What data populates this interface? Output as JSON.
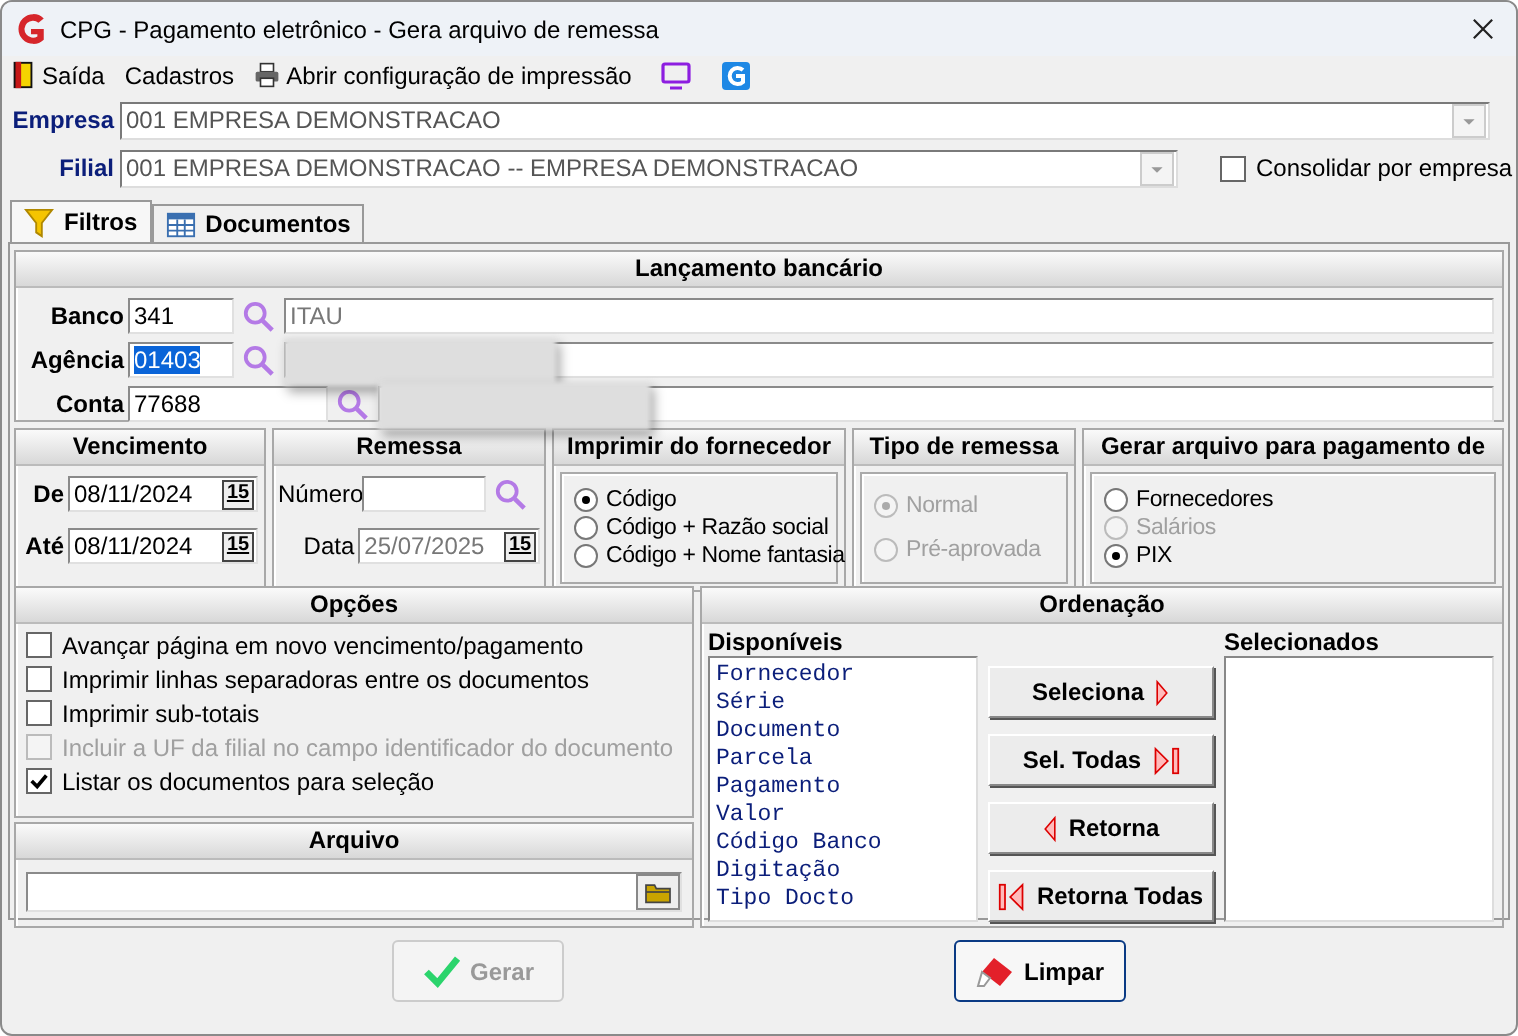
{
  "window": {
    "title": "CPG -  Pagamento eletrônico - Gera arquivo de remessa"
  },
  "menu": [
    {
      "label": "Saída"
    },
    {
      "label": "Cadastros"
    },
    {
      "label": "Abrir configuração de impressão"
    }
  ],
  "empresa": {
    "label": "Empresa",
    "value": "001 EMPRESA DEMONSTRACAO"
  },
  "filial": {
    "label": "Filial",
    "value": "001 EMPRESA DEMONSTRACAO -- EMPRESA DEMONSTRACAO"
  },
  "consolidar": {
    "label": "Consolidar por empresa",
    "checked": false
  },
  "tabs": [
    {
      "label": "Filtros",
      "selected": true
    },
    {
      "label": "Documentos",
      "selected": false
    }
  ],
  "lancamento": {
    "title": "Lançamento bancário",
    "fields": [
      {
        "label": "Banco",
        "value": "341",
        "name": "ITAU",
        "selected": false,
        "redacted": false
      },
      {
        "label": "Agência",
        "value": "01403",
        "selected": true,
        "redacted": true
      },
      {
        "label": "Conta",
        "value": "77688",
        "selected": false,
        "redacted": true
      }
    ]
  },
  "vencimento": {
    "title": "Vencimento",
    "fields": [
      {
        "label": "De",
        "value": "08/11/2024",
        "button": "15"
      },
      {
        "label": "Até",
        "value": "08/11/2024",
        "button": "15"
      }
    ]
  },
  "remessa": {
    "title": "Remessa",
    "numero": {
      "label": "Número"
    },
    "data": {
      "label": "Data",
      "value": "25/07/2025",
      "button": "15",
      "disabled": true
    }
  },
  "imprimir": {
    "title": "Imprimir do fornecedor",
    "options": [
      {
        "label": "Código",
        "selected": true,
        "disabled": false
      },
      {
        "label": "Código + Razão social",
        "selected": false,
        "disabled": false
      },
      {
        "label": "Código + Nome fantasia",
        "selected": false,
        "disabled": false
      }
    ]
  },
  "tipo_remessa": {
    "title": "Tipo de remessa",
    "options": [
      {
        "label": "Normal",
        "selected": true,
        "disabled": true
      },
      {
        "label": "Pré-aprovada",
        "selected": false,
        "disabled": true
      }
    ]
  },
  "gerar_para": {
    "title": "Gerar arquivo para pagamento de",
    "options": [
      {
        "label": "Fornecedores",
        "selected": false,
        "disabled": false
      },
      {
        "label": "Salários",
        "selected": false,
        "disabled": true
      },
      {
        "label": "PIX",
        "selected": true,
        "disabled": false
      }
    ]
  },
  "opcoes": {
    "title": "Opções",
    "items": [
      {
        "label": "Avançar página em novo vencimento/pagamento",
        "checked": false,
        "disabled": false
      },
      {
        "label": "Imprimir linhas separadoras entre os documentos",
        "checked": false,
        "disabled": false
      },
      {
        "label": "Imprimir sub-totais",
        "checked": false,
        "disabled": false
      },
      {
        "label": "Incluir a UF da filial no campo identificador do documento",
        "checked": false,
        "disabled": true
      },
      {
        "label": "Listar os documentos para seleção",
        "checked": true,
        "disabled": false
      }
    ]
  },
  "arquivo": {
    "title": "Arquivo"
  },
  "ordenacao": {
    "title": "Ordenação",
    "available": {
      "label": "Disponíveis",
      "items": [
        "Fornecedor",
        "Série",
        "Documento",
        "Parcela",
        "Pagamento",
        "Valor",
        "Código Banco",
        "Digitação",
        "Tipo Docto"
      ]
    },
    "chosen": {
      "label": "Selecionados"
    },
    "buttons": [
      {
        "label": "Seleciona",
        "kind": "right"
      },
      {
        "label": "Sel. Todas",
        "kind": "all_right"
      },
      {
        "label": "Retorna",
        "kind": "left"
      },
      {
        "label": "Retorna Todas",
        "kind": "all_left"
      }
    ]
  },
  "actions": [
    {
      "label": "Gerar",
      "kind": "check",
      "disabled": true
    },
    {
      "label": "Limpar",
      "kind": "eraser",
      "disabled": false
    }
  ]
}
